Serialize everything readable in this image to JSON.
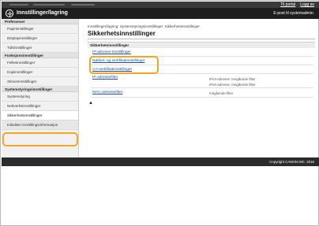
{
  "header": {
    "links": [
      "Til portal",
      "Logg av"
    ],
    "title": "Innstillinger/lagring",
    "email_link": "E-post til systemadmin."
  },
  "sidebar": {
    "sections": [
      {
        "heading": "Preferanser",
        "items": [
          "Papirinnstillinger",
          "Displayinnstillinger",
          "Tidsinnstillinger"
        ]
      },
      {
        "heading": "Funksjonsinnstillinger",
        "items": [
          "Fellesinnstillinger",
          "Kopiinnstillinger",
          "Skriverinnstillinger"
        ]
      },
      {
        "heading": "Systemstyringsinnstillinger",
        "items": [
          "Systemstyring",
          "Nettverksinnstillinger",
          "Sikkerhetsinnstillinger"
        ]
      }
    ],
    "footer_item": "Initialiser innstillingsinformasjon"
  },
  "main": {
    "breadcrumb": "Innstillinger/lagring: Systemstyringsinnstillinger: Sikkerhetsinnstillinger",
    "title": "Sikkerhetsinnstillinger",
    "section_heading": "Sikkerhetsinnstillinger",
    "links": {
      "port": "IP-adresse-innstillinger",
      "keys": "Nøkkel- og sertifikatinnstillinger",
      "ca": "CA-sertifikatinnstillinger",
      "ip": "IP-adressefilter",
      "mac": "MAC-adressefilter"
    },
    "values": {
      "ipv4": "IPv4-adresse: Inngående filter",
      "ipv6": "IPv6-adresse: Inngående filter",
      "mac": "Inngående filter"
    },
    "top_glyph": "▲"
  },
  "footer": {
    "copyright": "Copyright CANON INC. 2016"
  },
  "colors": {
    "header": "#1e1e1e",
    "link": "#1a4fa3",
    "highlight": "#f5a623"
  }
}
